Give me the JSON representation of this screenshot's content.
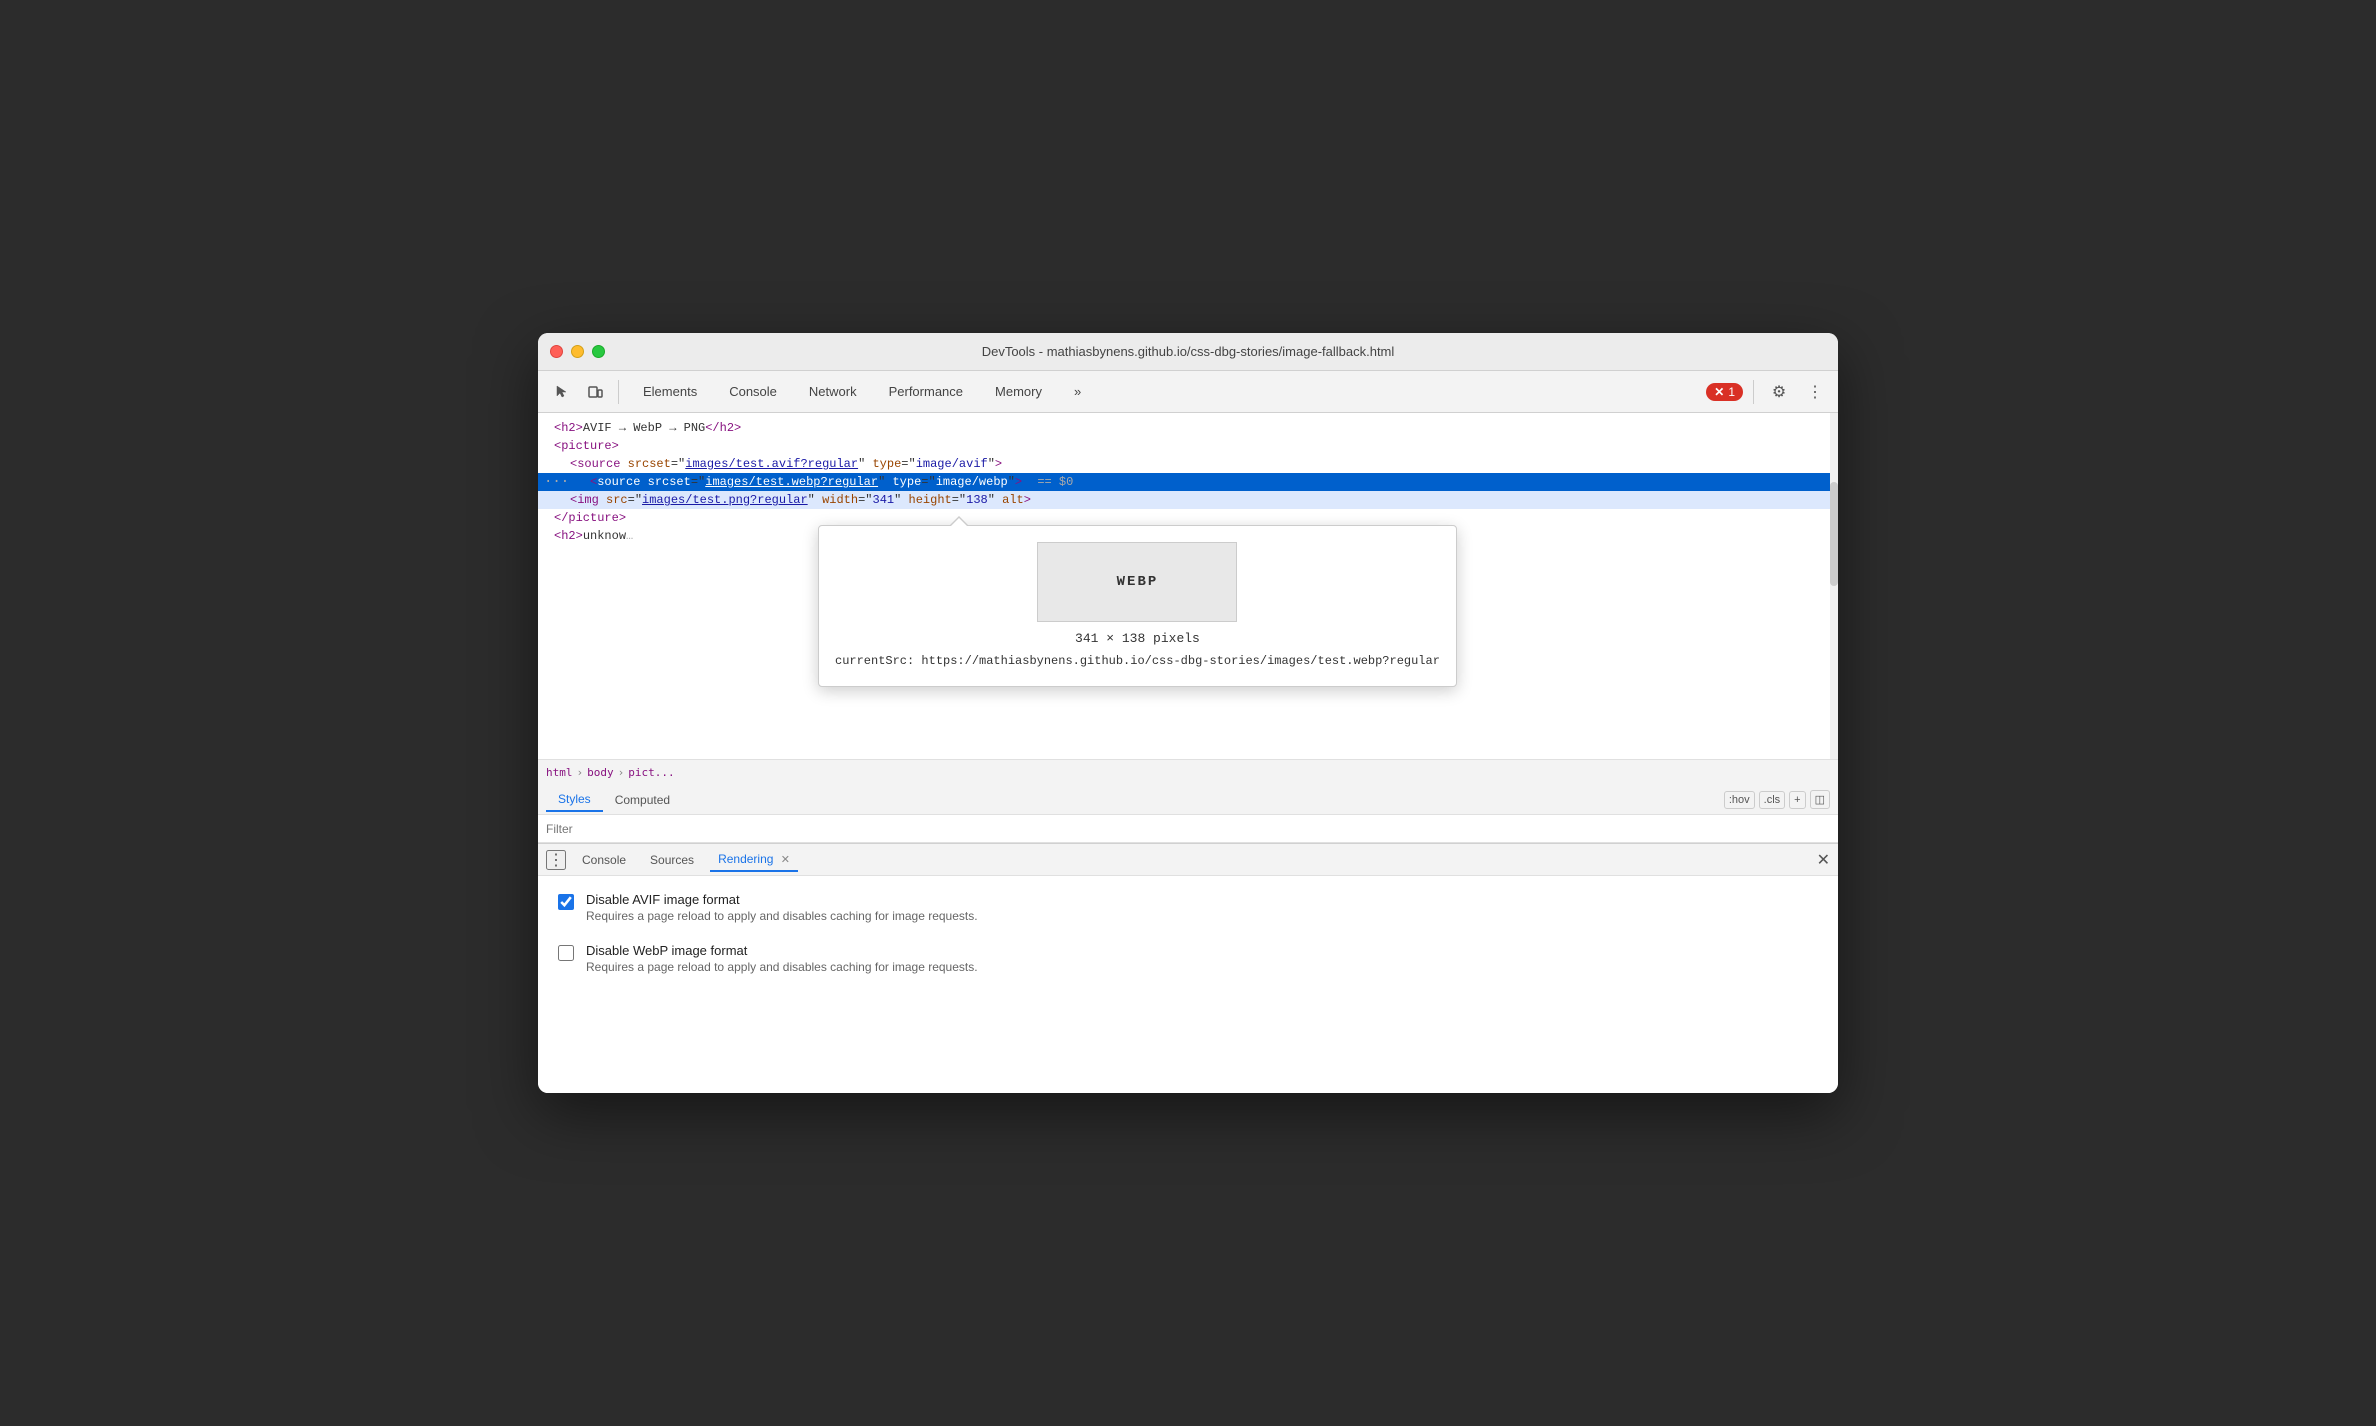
{
  "window": {
    "title": "DevTools - mathiasbynens.github.io/css-dbg-stories/image-fallback.html"
  },
  "toolbar": {
    "tabs": [
      {
        "id": "elements",
        "label": "Elements",
        "active": false
      },
      {
        "id": "console",
        "label": "Console",
        "active": false
      },
      {
        "id": "network",
        "label": "Network",
        "active": false
      },
      {
        "id": "performance",
        "label": "Performance",
        "active": false
      },
      {
        "id": "memory",
        "label": "Memory",
        "active": false
      }
    ],
    "more_label": "»",
    "error_count": "1",
    "settings_icon": "⚙",
    "more_icon": "⋮"
  },
  "elements_panel": {
    "lines": [
      {
        "id": "line1",
        "indent": 0,
        "content_type": "h2_avif",
        "raw": "<h2>AVIF → WebP → PNG</h2>"
      },
      {
        "id": "line2",
        "indent": 1,
        "content_type": "picture_open",
        "raw": "<picture>"
      },
      {
        "id": "line3",
        "indent": 2,
        "content_type": "source_avif",
        "raw": "<source srcset=\"images/test.avif?regular\" type=\"image/avif\">"
      },
      {
        "id": "line4",
        "indent": 2,
        "content_type": "source_webp",
        "raw": "<source srcset=\"images/test.webp?regular\" type=\"image/webp\">"
      },
      {
        "id": "line5",
        "indent": 2,
        "content_type": "img",
        "raw": "<img src=\"images/test.png?regular\" width=\"341\" height=\"138\" alt>"
      },
      {
        "id": "line6",
        "indent": 1,
        "content_type": "picture_close",
        "raw": "</picture>"
      },
      {
        "id": "line7",
        "indent": 0,
        "content_type": "h2_unknown",
        "raw": "<h2>unknow..."
      }
    ]
  },
  "breadcrumb": {
    "items": [
      "html",
      "body",
      "pict..."
    ]
  },
  "style_tabs": [
    {
      "id": "styles",
      "label": "Styles",
      "active": true
    },
    {
      "id": "computed",
      "label": "Computed",
      "active": false
    }
  ],
  "filter": {
    "placeholder": "Filter"
  },
  "styles_toolbar": {
    "hover_label": ":hov",
    "cls_label": ".cls",
    "plus_label": "+",
    "toggle_icon": "◫"
  },
  "tooltip": {
    "image_label": "WEBP",
    "dimensions": "341 × 138 pixels",
    "current_src_label": "currentSrc:",
    "current_src_value": "https://mathiasbynens.github.io/css-dbg-stories/images/test.webp?regular"
  },
  "drawer": {
    "tabs": [
      {
        "id": "console",
        "label": "Console",
        "active": false,
        "closeable": false
      },
      {
        "id": "sources",
        "label": "Sources",
        "active": false,
        "closeable": false
      },
      {
        "id": "rendering",
        "label": "Rendering",
        "active": true,
        "closeable": true
      }
    ]
  },
  "rendering": {
    "options": [
      {
        "id": "disable-avif",
        "label": "Disable AVIF image format",
        "description": "Requires a page reload to apply and disables caching for image requests.",
        "checked": true
      },
      {
        "id": "disable-webp",
        "label": "Disable WebP image format",
        "description": "Requires a page reload to apply and disables caching for image requests.",
        "checked": false
      }
    ]
  }
}
